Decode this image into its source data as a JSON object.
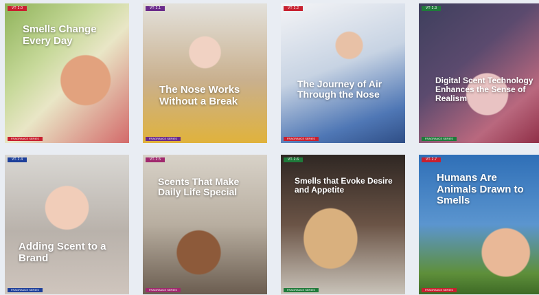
{
  "cards": [
    {
      "badge": "VT·2.0",
      "badge_color": "#c8202f",
      "title": "Smells Change Every Day",
      "footer": "FRAGRANCE SERIES",
      "footer_color": "#c8202f"
    },
    {
      "badge": "VT·2.1",
      "badge_color": "#6a2a8a",
      "title": "The Nose Works Without a Break",
      "footer": "FRAGRANCE SERIES",
      "footer_color": "#6a2a8a"
    },
    {
      "badge": "VT·2.2",
      "badge_color": "#c8202f",
      "title": "The Journey of Air Through the Nose",
      "footer": "FRAGRANCE SERIES",
      "footer_color": "#c8202f"
    },
    {
      "badge": "VT·2.3",
      "badge_color": "#1f7a3a",
      "title": "Digital Scent Technology Enhances the Sense of Realism",
      "footer": "FRAGRANCE SERIES",
      "footer_color": "#1f7a3a"
    },
    {
      "badge": "VT·2.4",
      "badge_color": "#1d3f9a",
      "title": "Adding Scent to a Brand",
      "footer": "FRAGRANCE SERIES",
      "footer_color": "#1d3f9a"
    },
    {
      "badge": "VT·2.5",
      "badge_color": "#a0286e",
      "title": "Scents That Make Daily Life Special",
      "footer": "FRAGRANCE SERIES",
      "footer_color": "#a0286e"
    },
    {
      "badge": "VT·2.6",
      "badge_color": "#1f7a3a",
      "title": "Smells that Evoke Desire and Appetite",
      "footer": "FRAGRANCE SERIES",
      "footer_color": "#1f7a3a"
    },
    {
      "badge": "VT·2.7",
      "badge_color": "#c8202f",
      "title": "Humans Are Animals Drawn to Smells",
      "footer": "FRAGRANCE SERIES",
      "footer_color": "#c8202f"
    }
  ]
}
